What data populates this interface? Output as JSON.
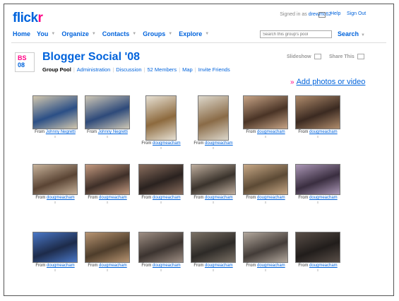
{
  "header": {
    "logo_flick": "flick",
    "logo_r": "r",
    "signed_in_prefix": "Signed in as",
    "username": "drewmc62",
    "help": "Help",
    "sign_out": "Sign Out"
  },
  "nav": {
    "items": [
      "Home",
      "You",
      "Organize",
      "Contacts",
      "Groups",
      "Explore"
    ],
    "search_placeholder": "Search this group's pool",
    "search_label": "Search"
  },
  "group": {
    "title": "Blogger Social '08",
    "icon_top": "BS",
    "icon_bottom": "08",
    "tabs": [
      "Group Pool",
      "Administration",
      "Discussion",
      "52 Members",
      "Map",
      "Invite Friends"
    ],
    "slideshow": "Slideshow",
    "share": "Share This",
    "add_arrows": "»",
    "add_photos": "Add photos or video"
  },
  "photos": {
    "from_label": "From",
    "remove_mark": "x",
    "items": [
      {
        "by": "Johnny Negretti"
      },
      {
        "by": "Johnny Negretti"
      },
      {
        "by": "dougmeacham"
      },
      {
        "by": "dougmeacham"
      },
      {
        "by": "dougmeacham"
      },
      {
        "by": "dougmeacham"
      },
      {
        "by": "dougmeacham"
      },
      {
        "by": "dougmeacham"
      },
      {
        "by": "dougmeacham"
      },
      {
        "by": "dougmeacham"
      },
      {
        "by": "dougmeacham"
      },
      {
        "by": "dougmeacham"
      },
      {
        "by": "dougmeacham"
      },
      {
        "by": "dougmeacham"
      },
      {
        "by": "dougmeacham"
      },
      {
        "by": "dougmeacham"
      },
      {
        "by": "dougmeacham"
      },
      {
        "by": "dougmeacham"
      }
    ]
  }
}
